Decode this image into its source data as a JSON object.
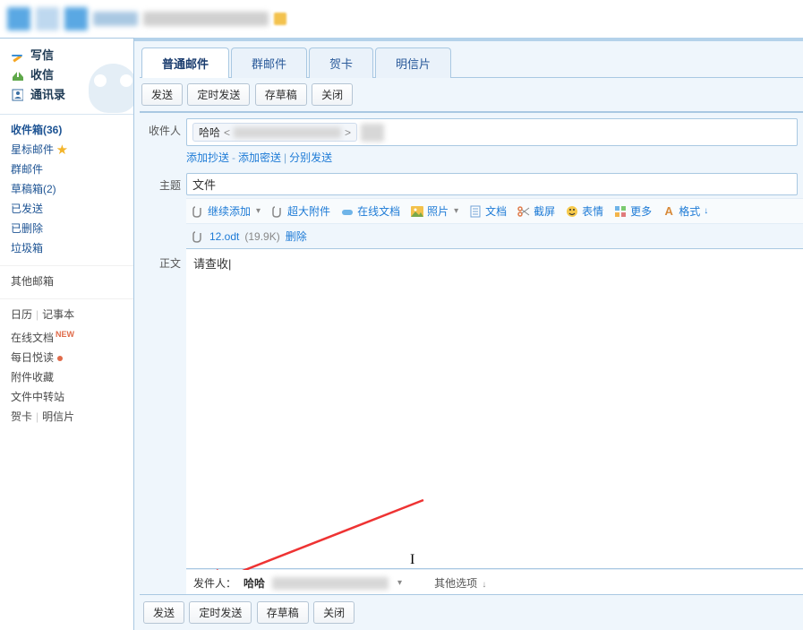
{
  "sidebar": {
    "compose": "写信",
    "receive": "收信",
    "contacts": "通讯录",
    "folders": {
      "inbox": "收件箱(36)",
      "starred": "星标邮件",
      "group": "群邮件",
      "drafts": "草稿箱(2)",
      "sent": "已发送",
      "deleted": "已删除",
      "spam": "垃圾箱"
    },
    "other_mailboxes": "其他邮箱",
    "utils": {
      "calendar": "日历",
      "notepad": "记事本",
      "online_doc": "在线文档",
      "daily_read": "每日悦读",
      "fav_attach": "附件收藏",
      "file_transfer": "文件中转站",
      "greeting": "贺卡",
      "postcard": "明信片"
    }
  },
  "tabs": {
    "normal": "普通邮件",
    "group": "群邮件",
    "greeting": "贺卡",
    "postcard": "明信片"
  },
  "toolbar": {
    "send": "发送",
    "timed_send": "定时发送",
    "save_draft": "存草稿",
    "close": "关闭"
  },
  "form": {
    "recipient_label": "收件人",
    "recipient_name": "哈哈",
    "add_cc": "添加抄送",
    "add_bcc": "添加密送",
    "separate_send": "分别发送",
    "subject_label": "主题",
    "subject_value": "文件",
    "body_label": "正文",
    "body_text": "请查收"
  },
  "rich": {
    "continue_add": "继续添加",
    "big_attach": "超大附件",
    "online_doc": "在线文档",
    "photo": "照片",
    "doc": "文档",
    "screenshot": "截屏",
    "emoji": "表情",
    "more": "更多",
    "format": "格式"
  },
  "attachment": {
    "name": "12.odt",
    "size": "(19.9K)",
    "delete": "删除"
  },
  "sender": {
    "label": "发件人：",
    "name": "哈哈",
    "other_options": "其他选项"
  }
}
